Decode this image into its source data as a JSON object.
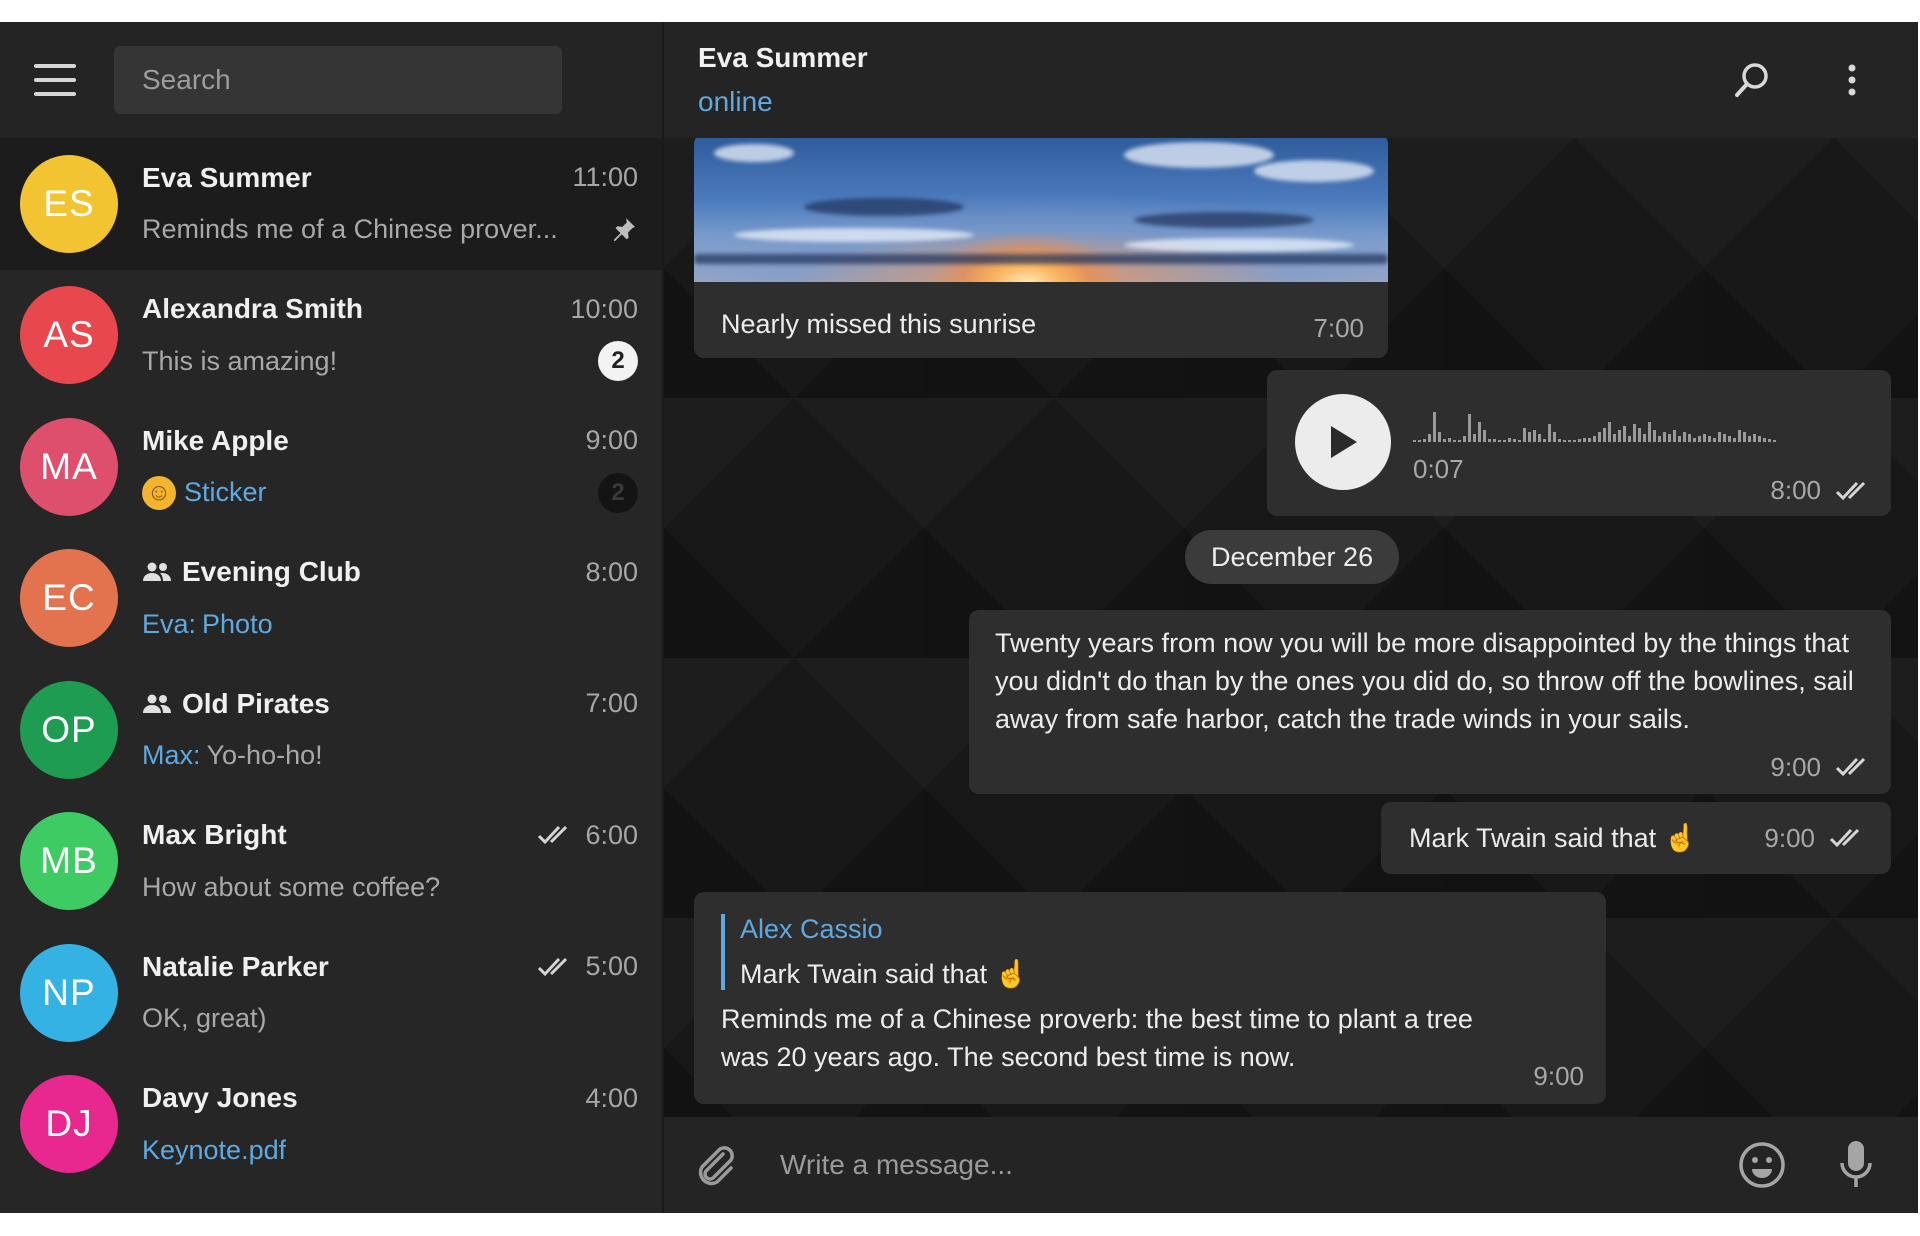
{
  "sidebar": {
    "search_placeholder": "Search",
    "chats": [
      {
        "initials": "ES",
        "color": "#f2c432",
        "name": "Eva Summer",
        "time": "11:00",
        "preview": "Reminds me of a Chinese prover...",
        "pinned": true
      },
      {
        "initials": "AS",
        "color": "#e8484d",
        "name": "Alexandra Smith",
        "time": "10:00",
        "preview": "This is amazing!",
        "badge": "2"
      },
      {
        "initials": "MA",
        "color": "#dd4f6d",
        "name": "Mike Apple",
        "time": "9:00",
        "preview": "Sticker",
        "badge": "2",
        "badge_muted": true
      },
      {
        "initials": "EC",
        "color": "#e3734f",
        "name": "Evening Club",
        "time": "8:00",
        "preview_sender": "Eva:",
        "preview": "Photo",
        "group": true
      },
      {
        "initials": "OP",
        "color": "#1d9c52",
        "name": "Old Pirates",
        "time": "7:00",
        "preview_sender": "Max:",
        "preview": "Yo-ho-ho!",
        "group": true
      },
      {
        "initials": "MB",
        "color": "#3fcb63",
        "name": "Max Bright",
        "time": "6:00",
        "preview": "How about some coffee?",
        "read": true
      },
      {
        "initials": "NP",
        "color": "#33b2e3",
        "name": "Natalie Parker",
        "time": "5:00",
        "preview": "OK, great)",
        "read": true
      },
      {
        "initials": "DJ",
        "color": "#e8288f",
        "name": "Davy Jones",
        "time": "4:00",
        "preview": "Keynote.pdf"
      }
    ]
  },
  "header": {
    "peer_name": "Eva Summer",
    "peer_status": "online"
  },
  "messages": {
    "photo": {
      "caption": "Nearly missed this sunrise",
      "time": "7:00"
    },
    "voice": {
      "duration": "0:07",
      "time": "8:00"
    },
    "date_separator": "December 26",
    "quote": {
      "text": "Twenty years from now you will be more disappointed by the things that you didn't do than by the ones you did do, so throw off the bowlines, sail away from safe harbor, catch the trade winds in your sails.",
      "time": "9:00"
    },
    "twain": {
      "text": "Mark Twain said that ☝️",
      "time": "9:00"
    },
    "reply": {
      "author": "Alex Cassio",
      "quoted_text": "Mark Twain said that ☝️",
      "text": "Reminds me of a Chinese proverb: the best time to plant a tree was 20 years ago. The second best time is now.",
      "time": "9:00"
    }
  },
  "composer": {
    "placeholder": "Write a message..."
  },
  "colors": {
    "accent": "#5fa9e0",
    "bubble": "#2e2e2e",
    "sidebar": "#262626"
  }
}
